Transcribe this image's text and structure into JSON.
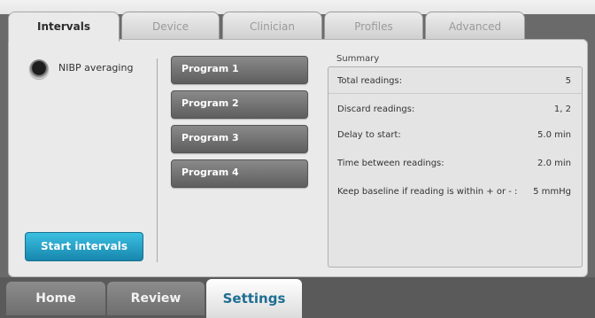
{
  "tabs": [
    "Intervals",
    "Device",
    "Clinician",
    "Profiles",
    "Advanced"
  ],
  "active_tab": "Intervals",
  "nibp": {
    "label": "NIBP averaging",
    "selected": true
  },
  "programs": [
    "Program 1",
    "Program 2",
    "Program 3",
    "Program 4"
  ],
  "start_button": "Start intervals",
  "summary": {
    "title": "Summary",
    "rows": [
      {
        "label": "Total readings:",
        "value": "5"
      },
      {
        "label": "Discard readings:",
        "value": "1, 2"
      },
      {
        "label": "Delay to start:",
        "value": "5.0 min"
      },
      {
        "label": "Time between readings:",
        "value": "2.0 min"
      },
      {
        "label": "Keep baseline if reading is within + or - :",
        "value": "5 mmHg"
      }
    ]
  },
  "nav": [
    "Home",
    "Review",
    "Settings"
  ],
  "active_nav": "Settings",
  "colors": {
    "accent": "#1786ad",
    "active_nav_text": "#1e6e92"
  }
}
